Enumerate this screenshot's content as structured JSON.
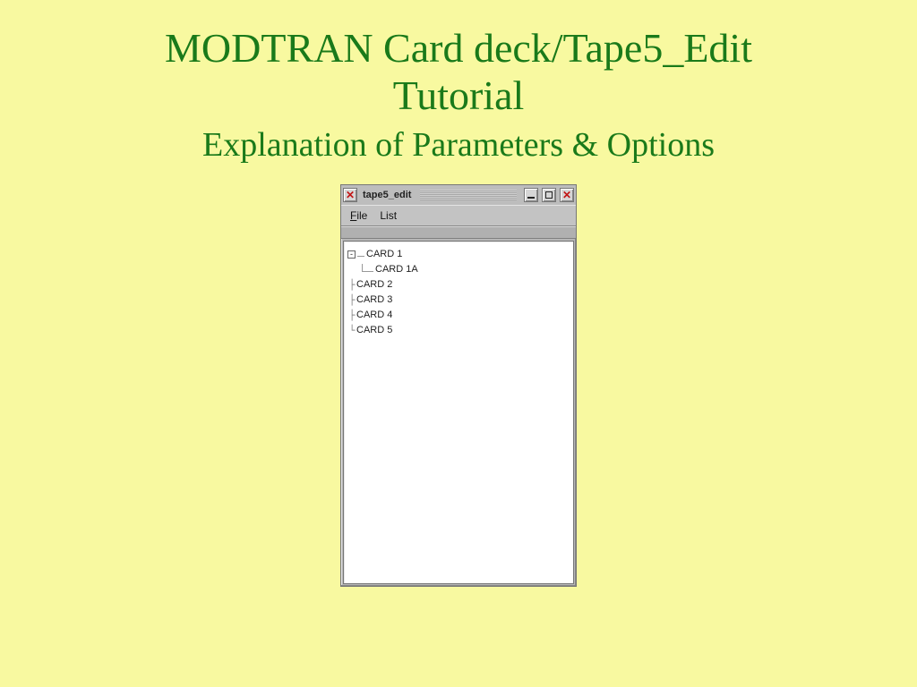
{
  "title": {
    "line1": "MODTRAN Card deck/Tape5_Edit",
    "line2": "Tutorial",
    "subtitle": "Explanation of Parameters & Options"
  },
  "window": {
    "title": "tape5_edit",
    "close_left_glyph": "✕",
    "close_right_glyph": "✕",
    "menu": {
      "file": "File",
      "file_accel": "F",
      "list": "List"
    },
    "tree": {
      "root": "CARD 1",
      "root_child": "CARD 1A",
      "items": [
        "CARD 2",
        "CARD 3",
        "CARD 4",
        "CARD 5"
      ]
    }
  }
}
